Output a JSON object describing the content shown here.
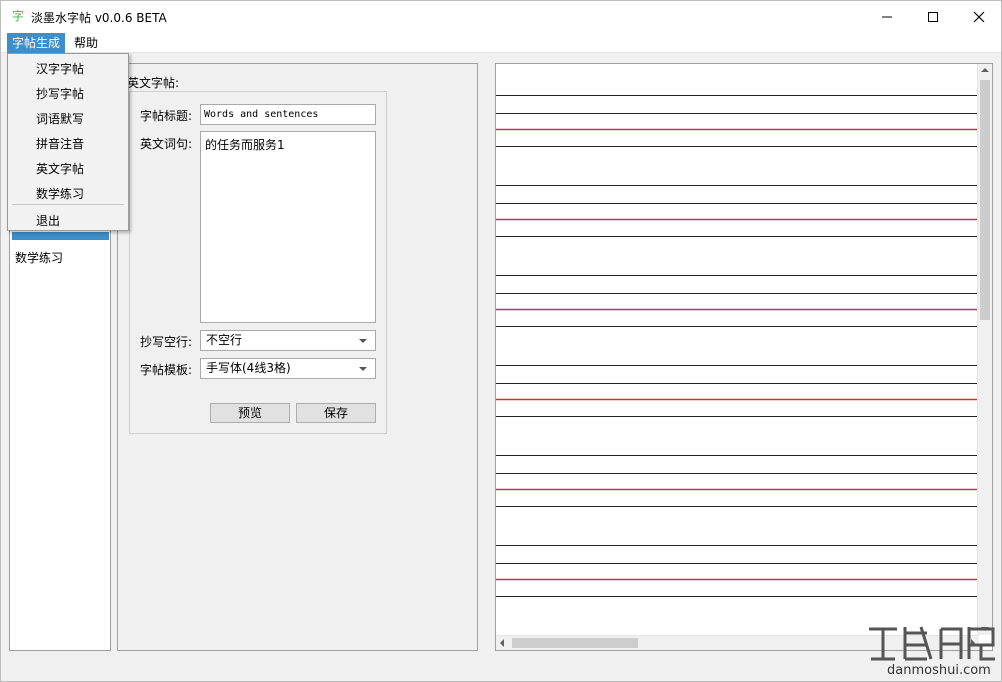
{
  "window": {
    "title": "淡墨水字帖 v0.0.6 BETA",
    "icon": "字"
  },
  "menubar": {
    "items": [
      "字帖生成",
      "帮助"
    ]
  },
  "dropdown": {
    "items": [
      "汉字字帖",
      "抄写字帖",
      "词语默写",
      "拼音注音",
      "英文字帖",
      "数学练习"
    ],
    "exit": "退出"
  },
  "sidebar": {
    "items": [
      "数学练习"
    ]
  },
  "form": {
    "group_title": "英文字帖:",
    "title_label": "字帖标题:",
    "title_value": "Words and sentences",
    "words_label": "英文词句:",
    "words_value": "的任务而服务1",
    "blank_label": "抄写空行:",
    "blank_value": "不空行",
    "template_label": "字帖模板:",
    "template_value": "手写体(4线3格)",
    "preview_button": "预览",
    "save_button": "保存"
  },
  "colors": {
    "accent": "#3d8ec9",
    "red_line": "#c0392b"
  },
  "watermark": {
    "site": "danmoshui.com"
  }
}
